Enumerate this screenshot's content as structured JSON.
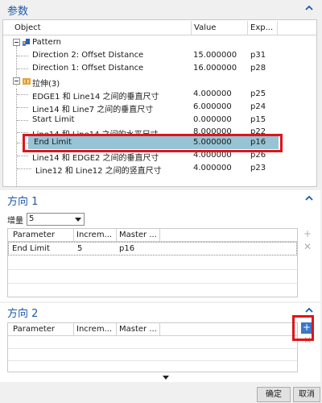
{
  "parameters": {
    "title": "参数",
    "columns": [
      "Object",
      "Value",
      "Exp..."
    ],
    "rows": [
      {
        "object": "Pattern",
        "value": "",
        "exp": "",
        "kind": "group"
      },
      {
        "object": "Direction 2: Offset Distance",
        "value": "15.000000",
        "exp": "p31"
      },
      {
        "object": "Direction 1: Offset Distance",
        "value": "16.000000",
        "exp": "p28"
      },
      {
        "object": "拉伸(3)",
        "value": "",
        "exp": "",
        "kind": "group"
      },
      {
        "object": "EDGE1 和 Line14 之间的垂直尺寸",
        "value": "4.000000",
        "exp": "p25"
      },
      {
        "object": "Line14 和 Line7 之间的垂直尺寸",
        "value": "6.000000",
        "exp": "p24"
      },
      {
        "object": "Start Limit",
        "value": "0.000000",
        "exp": "p15"
      },
      {
        "object": "Line14 和 Line14 之间的水平尺寸",
        "value": "8.000000",
        "exp": "p22"
      },
      {
        "object": "End Limit",
        "value": "5.000000",
        "exp": "p16"
      },
      {
        "object": "Line14 和 EDGE2 之间的垂直尺寸",
        "value": "4.000000",
        "exp": "p26"
      },
      {
        "object": "Line12 和 Line12 之间的竖直尺寸",
        "value": "4.000000",
        "exp": "p23"
      }
    ]
  },
  "direction1": {
    "title": "方向 1",
    "step_label": "增量",
    "step_value": "5",
    "columns": [
      "Parameter",
      "Increm...",
      "Master ..."
    ],
    "rows": [
      {
        "parameter": "End Limit",
        "increment": "5",
        "master": "p16"
      }
    ]
  },
  "direction2": {
    "title": "方向 2",
    "columns": [
      "Parameter",
      "Increm...",
      "Master ..."
    ],
    "rows": []
  },
  "buttons": {
    "ok": "确定",
    "cancel": "取消"
  },
  "colors": {
    "accent": "#1e5aa8",
    "selection": "#96c4d4",
    "highlight_box": "#e0141b"
  },
  "icons": {
    "collapse": "chevron-up-icon",
    "pattern": "pattern-feature-icon",
    "extrude": "extrude-feature-icon",
    "add": "add-icon",
    "delete": "delete-icon"
  }
}
